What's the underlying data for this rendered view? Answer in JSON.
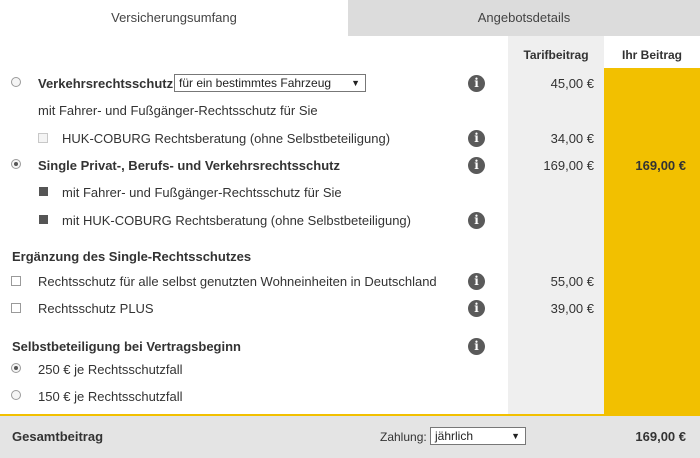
{
  "tabs": [
    {
      "label": "Versicherungsumfang",
      "active": true
    },
    {
      "label": "Angebotsdetails",
      "active": false
    }
  ],
  "columns": {
    "tarif": "Tarifbeitrag",
    "ihr": "Ihr Beitrag"
  },
  "rows": {
    "verkehr": {
      "label": "Verkehrsrechtsschutz",
      "select_value": "für ein bestimmtes Fahrzeug",
      "tarif": "45,00 €"
    },
    "verkehr_sub1": {
      "label": "mit Fahrer- und Fußgänger-Rechtsschutz für Sie"
    },
    "verkehr_sub2": {
      "label": "HUK-COBURG Rechtsberatung (ohne Selbstbeteiligung)",
      "tarif": "34,00 €"
    },
    "single": {
      "label": "Single Privat-, Berufs- und Verkehrsrechtsschutz",
      "tarif": "169,00 €",
      "ihr": "169,00 €"
    },
    "single_sub1": {
      "label": "mit Fahrer- und Fußgänger-Rechtsschutz für Sie"
    },
    "single_sub2": {
      "label": "mit HUK-COBURG Rechtsberatung (ohne Selbstbeteiligung)"
    }
  },
  "erganzung": {
    "title": "Ergänzung des Single-Rechtsschutzes",
    "wohn": {
      "label": "Rechtsschutz für alle selbst genutzten Wohneinheiten in Deutschland",
      "tarif": "55,00 €"
    },
    "plus": {
      "label": "Rechtsschutz PLUS",
      "tarif": "39,00 €"
    }
  },
  "selbst": {
    "title": "Selbstbeteiligung bei Vertragsbeginn",
    "opt250": "250 € je Rechtsschutzfall",
    "opt150": "150 € je Rechtsschutzfall"
  },
  "footer": {
    "label": "Gesamtbeitrag",
    "zahlung_label": "Zahlung:",
    "zahlung_value": "jährlich",
    "total": "169,00 €"
  },
  "icons": {
    "info": "i",
    "caret": "▼"
  },
  "colors": {
    "accent": "#f2c000",
    "tarif_bg": "#efefef",
    "inactive_tab": "#dcdcdc"
  }
}
